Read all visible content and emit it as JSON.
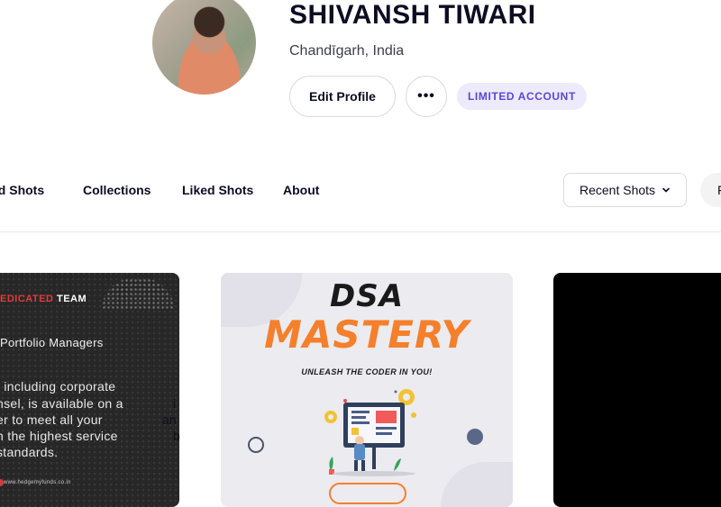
{
  "profile": {
    "name": "SHIVANSH TIWARI",
    "location": "Chandīgarh, India",
    "edit_label": "Edit Profile",
    "more_label": "•••",
    "badge": "LIMITED ACCOUNT"
  },
  "tabs": [
    "ed Shots",
    "Collections",
    "Liked Shots",
    "About"
  ],
  "sort": {
    "label": "Recent Shots"
  },
  "filters": {
    "label": "F"
  },
  "shots": [
    {
      "dedicated_prefix": "EDICATED",
      "dedicated_suffix": " TEAM",
      "heading": "Portfolio Managers",
      "lines": [
        ", including corporate",
        "nsel, is available on a",
        "er to meet all your",
        "h the highest service",
        " standards."
      ],
      "footer": "www.hedgemyfunds.co.in"
    },
    {
      "title": "DSA",
      "subtitle": "MASTERY",
      "tagline": "UNLEASH THE CODER IN YOU!"
    },
    {}
  ],
  "fragments": [
    "i",
    "an",
    "b"
  ],
  "colors": {
    "badge_bg": "#edeafc",
    "badge_text": "#5b47d6",
    "mastery_orange": "#f57f2b",
    "dedicated_red": "#e23b3b"
  }
}
